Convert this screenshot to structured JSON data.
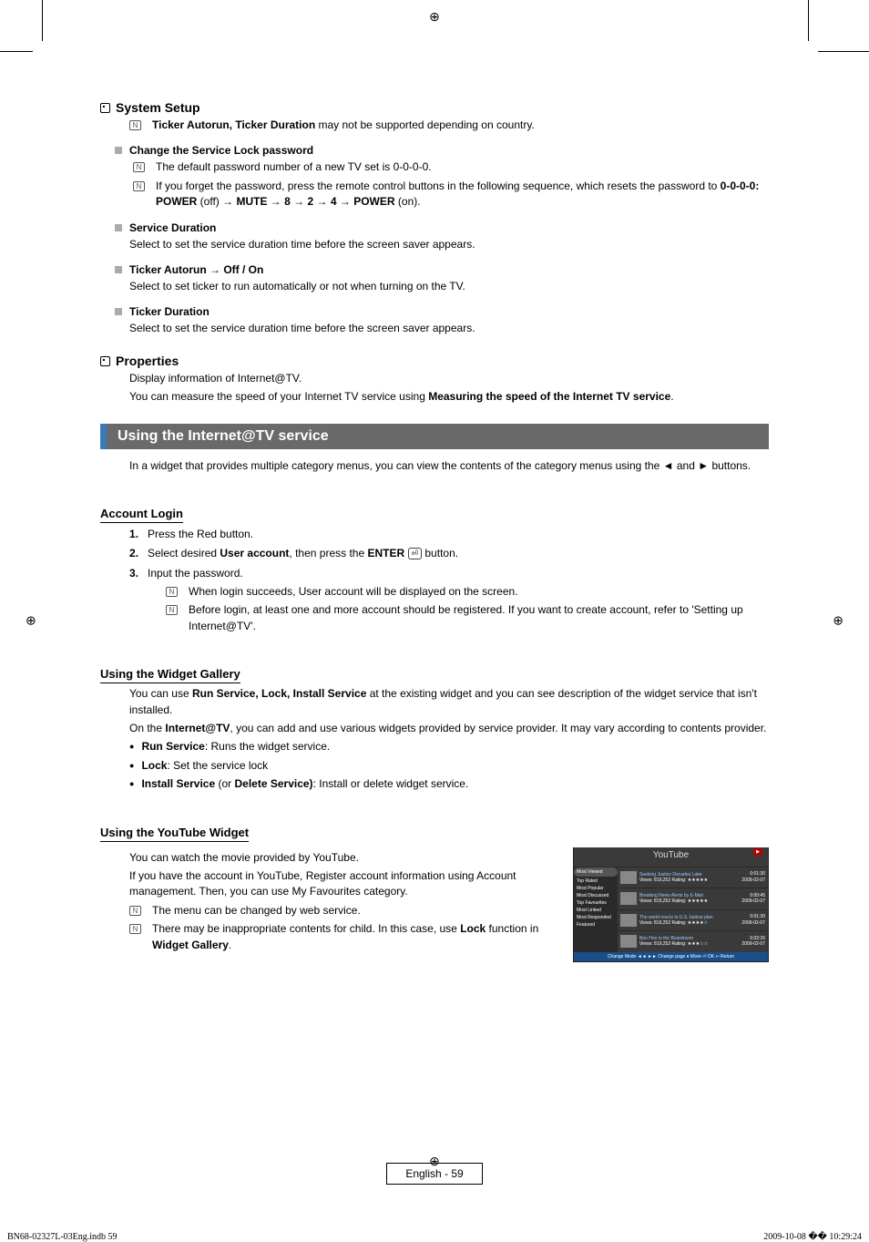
{
  "systemSetup": {
    "title": "System Setup",
    "note1": "Ticker Autorun, Ticker Duration",
    "note1_rest": " may not be supported depending on country.",
    "changeLock": {
      "title": "Change the Service Lock password",
      "note1": "The default password number of a new TV set is 0-0-0-0.",
      "note2_a": "If you forget the password, press the remote control buttons in the following sequence, which resets the password to ",
      "note2_b": "0-0-0-0: POWER",
      "note2_c": " (off) → ",
      "note2_d": "MUTE",
      "note2_e": " → ",
      "note2_f": "8",
      "note2_g": " → ",
      "note2_h": "2",
      "note2_i": " → ",
      "note2_j": "4",
      "note2_k": " → ",
      "note2_l": "POWER",
      "note2_m": " (on)."
    },
    "serviceDuration": {
      "title": "Service Duration",
      "body": "Select to set the service duration time before the screen saver appears."
    },
    "tickerAutorun": {
      "title": "Ticker Autorun → Off / On",
      "body": "Select to set ticker to run automatically or not when turning on the TV."
    },
    "tickerDuration": {
      "title": "Ticker Duration",
      "body": "Select to set the service duration time before the screen saver appears."
    }
  },
  "properties": {
    "title": "Properties",
    "line1": "Display information of Internet@TV.",
    "line2_a": "You can measure the speed of your Internet TV service using ",
    "line2_b": "Measuring the speed of the Internet TV service",
    "line2_c": "."
  },
  "usingService": {
    "heading": "Using the Internet@TV service",
    "intro": "In a widget that provides multiple category menus, you can view the contents of the category menus using the ◄ and ► buttons."
  },
  "accountLogin": {
    "title": "Account Login",
    "step1": "Press the Red button.",
    "step2_a": "Select desired ",
    "step2_b": "User account",
    "step2_c": ", then press the ",
    "step2_d": "ENTER",
    "step2_e": " button.",
    "step3": "Input the password.",
    "sub1": "When login succeeds, User account will be displayed on the screen.",
    "sub2": "Before login, at least one and more account should be registered. If you want to create account, refer to 'Setting up Internet@TV'."
  },
  "widgetGallery": {
    "title": "Using the Widget Gallery",
    "p1_a": "You can use ",
    "p1_b": "Run Service, Lock, Install Service",
    "p1_c": " at the existing widget and you can see description of the widget service that isn't installed.",
    "p2_a": "On the ",
    "p2_b": "Internet@TV",
    "p2_c": ", you can add and use various widgets provided by service provider. It may vary according to contents provider.",
    "b1_a": "Run Service",
    "b1_b": ": Runs the widget service.",
    "b2_a": "Lock",
    "b2_b": ": Set the service lock",
    "b3_a": "Install Service",
    "b3_b": " (or ",
    "b3_c": "Delete Service)",
    "b3_d": ": Install or delete widget service."
  },
  "youtube": {
    "title": "Using the YouTube Widget",
    "p1": "You can watch the movie provided by YouTube.",
    "p2": "If you have the account in YouTube, Register account information using Account management. Then, you can use My Favourites category.",
    "n1": "The menu can be changed by web service.",
    "n2_a": "There may be inappropriate contents for child. In this case, use ",
    "n2_b": "Lock",
    "n2_c": " function in ",
    "n2_d": "Widget Gallery",
    "n2_e": ".",
    "widget": {
      "logo": "YouTube",
      "side": [
        "Most Viewed",
        "Top Rated",
        "Most Popular",
        "Most Discussed",
        "Top Favourites",
        "Most Linked",
        "Most Responded",
        "Featured"
      ],
      "rows": [
        {
          "t": "Seeking Justice Decades Later",
          "v": "Views: 819,252   Rating: ★★★★★",
          "d": "0:01:30",
          "dt": "2009-02-07"
        },
        {
          "t": "Breaking News Alerts by E-Mail",
          "v": "Views: 819,252   Rating: ★★★★★",
          "d": "0:00:45",
          "dt": "2009-02-07"
        },
        {
          "t": "The world reacts to U.S. bailout plan",
          "v": "Views: 819,252   Rating: ★★★★☆",
          "d": "0:01:30",
          "dt": "2009-02-07"
        },
        {
          "t": "Boo Hoo in the Boardroom",
          "v": "Views: 819,252   Rating: ★★★☆☆",
          "d": "0:02:26",
          "dt": "2009-02-07"
        }
      ],
      "footer": "Change Mode   ◄◄ ►► Change page   ♦ Move   ⏎ OK   ↩ Return"
    }
  },
  "footer": {
    "pageLabel": "English - 59",
    "file": "BN68-02327L-03Eng.indb   59",
    "timestamp": "2009-10-08   �� 10:29:24"
  },
  "iconGlyph": {
    "note": "N",
    "enter": "⏎"
  }
}
